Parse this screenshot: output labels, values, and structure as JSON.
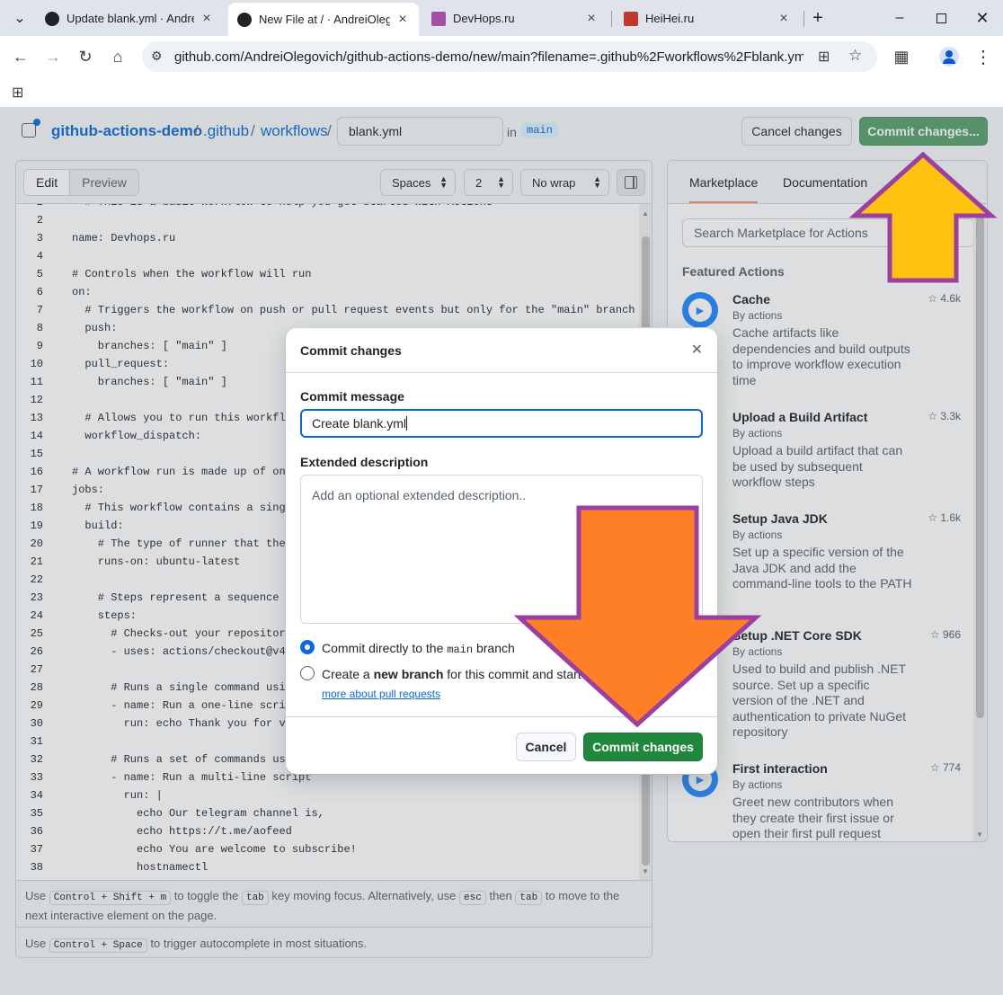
{
  "browser": {
    "tabs": [
      {
        "label": "Update blank.yml · AndreiO",
        "fav_color": "#1f2328"
      },
      {
        "label": "New File at / · AndreiOleg",
        "fav_color": "#1f2328"
      },
      {
        "label": "DevHops.ru",
        "fav_color": "#a34ea8"
      },
      {
        "label": "HeiHei.ru",
        "fav_color": "#c0392b"
      }
    ],
    "url": "github.com/AndreiOlegovich/github-actions-demo/new/main?filename=.github%2Fworkflows%2Fblank.yml&w..."
  },
  "header": {
    "repo": "github-actions-demo",
    "sep": "/",
    "folder1": ".github",
    "folder2": "workflows",
    "filename": "blank.yml",
    "in_label": "in",
    "branch": "main",
    "cancel_label": "Cancel changes",
    "commit_label": "Commit changes..."
  },
  "editor": {
    "tab_edit": "Edit",
    "tab_preview": "Preview",
    "indent_mode": "Spaces",
    "indent_size": "2",
    "wrap_mode": "No wrap",
    "lines": [
      {
        "n": "2",
        "t": "  # This is a basic workflow to help you get started with Actions"
      },
      {
        "n": "2",
        "t": ""
      },
      {
        "n": "3",
        "t": "name: Devhops.ru"
      },
      {
        "n": "4",
        "t": ""
      },
      {
        "n": "5",
        "t": "# Controls when the workflow will run"
      },
      {
        "n": "6",
        "t": "on:"
      },
      {
        "n": "7",
        "t": "  # Triggers the workflow on push or pull request events but only for the \"main\" branch"
      },
      {
        "n": "8",
        "t": "  push:"
      },
      {
        "n": "9",
        "t": "    branches: [ \"main\" ]"
      },
      {
        "n": "10",
        "t": "  pull_request:"
      },
      {
        "n": "11",
        "t": "    branches: [ \"main\" ]"
      },
      {
        "n": "12",
        "t": ""
      },
      {
        "n": "13",
        "t": "  # Allows you to run this workflow manually from the Actions tab"
      },
      {
        "n": "14",
        "t": "  workflow_dispatch:"
      },
      {
        "n": "15",
        "t": ""
      },
      {
        "n": "16",
        "t": "# A workflow run is made up of one or more jobs that can run sequentially or in parallel"
      },
      {
        "n": "17",
        "t": "jobs:"
      },
      {
        "n": "18",
        "t": "  # This workflow contains a single job called \"build\""
      },
      {
        "n": "19",
        "t": "  build:"
      },
      {
        "n": "20",
        "t": "    # The type of runner that the job will run on"
      },
      {
        "n": "21",
        "t": "    runs-on: ubuntu-latest"
      },
      {
        "n": "22",
        "t": ""
      },
      {
        "n": "23",
        "t": "    # Steps represent a sequence of tasks that will be executed as part of the job"
      },
      {
        "n": "24",
        "t": "    steps:"
      },
      {
        "n": "25",
        "t": "      # Checks-out your repository under $GITHUB_WORKSPACE, so your job can access it"
      },
      {
        "n": "26",
        "t": "      - uses: actions/checkout@v4"
      },
      {
        "n": "27",
        "t": ""
      },
      {
        "n": "28",
        "t": "      # Runs a single command using the runners shell"
      },
      {
        "n": "29",
        "t": "      - name: Run a one-line script"
      },
      {
        "n": "30",
        "t": "        run: echo Thank you for visiting Devhops.ru"
      },
      {
        "n": "31",
        "t": ""
      },
      {
        "n": "32",
        "t": "      # Runs a set of commands using the runners shell"
      },
      {
        "n": "33",
        "t": "      - name: Run a multi-line script"
      },
      {
        "n": "34",
        "t": "        run: |"
      },
      {
        "n": "35",
        "t": "          echo Our telegram channel is,"
      },
      {
        "n": "36",
        "t": "          echo https://t.me/aofeed"
      },
      {
        "n": "37",
        "t": "          echo You are welcome to subscribe!"
      },
      {
        "n": "38",
        "t": "          hostnamectl"
      }
    ],
    "hint1_a": "Use",
    "hint1_k1": "Control + Shift + m",
    "hint1_b": "to toggle the",
    "hint1_k2": "tab",
    "hint1_c": "key moving focus. Alternatively, use",
    "hint1_k3": "esc",
    "hint1_d": "then",
    "hint1_k4": "tab",
    "hint1_e": "to move to the next interactive element on the page.",
    "hint2_a": "Use",
    "hint2_k1": "Control + Space",
    "hint2_b": "to trigger autocomplete in most situations."
  },
  "marketplace": {
    "tab_marketplace": "Marketplace",
    "tab_docs": "Documentation",
    "search_placeholder": "Search Marketplace for Actions",
    "featured": "Featured Actions",
    "actions": [
      {
        "name": "Cache",
        "by": "By actions",
        "stars": "4.6k",
        "desc": "Cache artifacts like dependencies and build outputs to improve workflow execution time"
      },
      {
        "name": "Upload a Build Artifact",
        "by": "By actions",
        "stars": "3.3k",
        "desc": "Upload a build artifact that can be used by subsequent workflow steps"
      },
      {
        "name": "Setup Java JDK",
        "by": "By actions",
        "stars": "1.6k",
        "desc": "Set up a specific version of the Java JDK and add the command-line tools to the PATH"
      },
      {
        "name": "Setup .NET Core SDK",
        "by": "By actions",
        "stars": "966",
        "desc": "Used to build and publish .NET source. Set up a specific version of the .NET and authentication to private NuGet repository"
      },
      {
        "name": "First interaction",
        "by": "By actions",
        "stars": "774",
        "desc": "Greet new contributors when they create their first issue or open their first pull request"
      }
    ]
  },
  "dialog": {
    "title": "Commit changes",
    "message_label": "Commit message",
    "message_value": "Create blank.yml",
    "ext_label": "Extended description",
    "ext_placeholder": "Add an optional extended description..",
    "opt1_a": "Commit directly to the",
    "opt1_code": "main",
    "opt1_b": "branch",
    "opt2_a": "Create a",
    "opt2_bold": "new branch",
    "opt2_b": "for this commit and start a pull request",
    "learn_more": "more about pull requests",
    "cancel": "Cancel",
    "commit": "Commit changes"
  },
  "colors": {
    "primary_green": "#1f883d",
    "link_blue": "#0969da",
    "arrow_yellow": "#ffc20e",
    "arrow_orange": "#ff7f27",
    "arrow_outline": "#9b3fa1"
  }
}
